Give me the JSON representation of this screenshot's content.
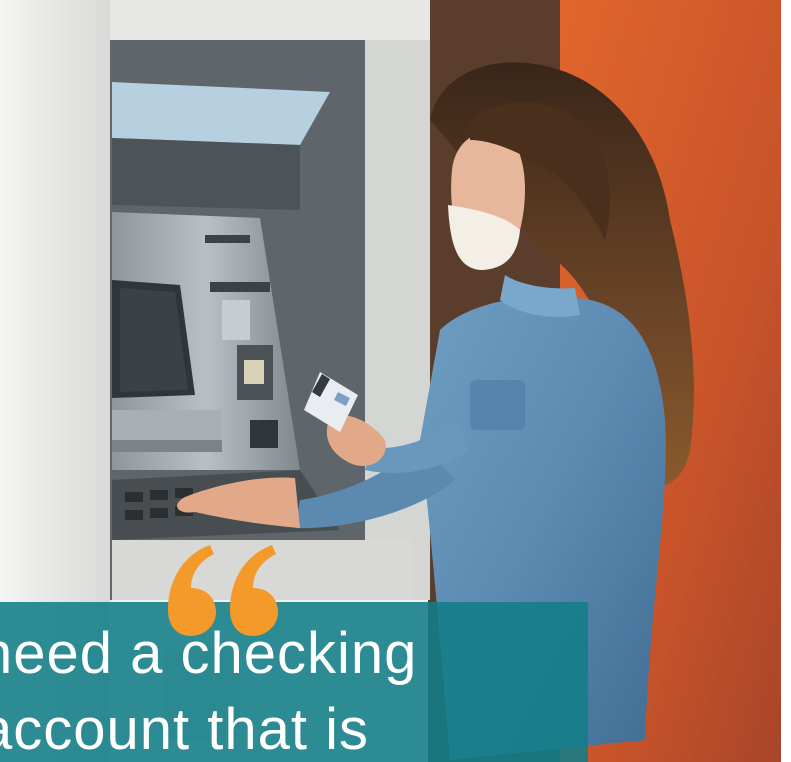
{
  "quote": {
    "text": "need a checking\naccount that is",
    "mark_color": "#f39a2b",
    "box_color": "#127d87"
  },
  "scene": {
    "wall_color": "#d9602a",
    "subject": "woman-at-atm"
  }
}
